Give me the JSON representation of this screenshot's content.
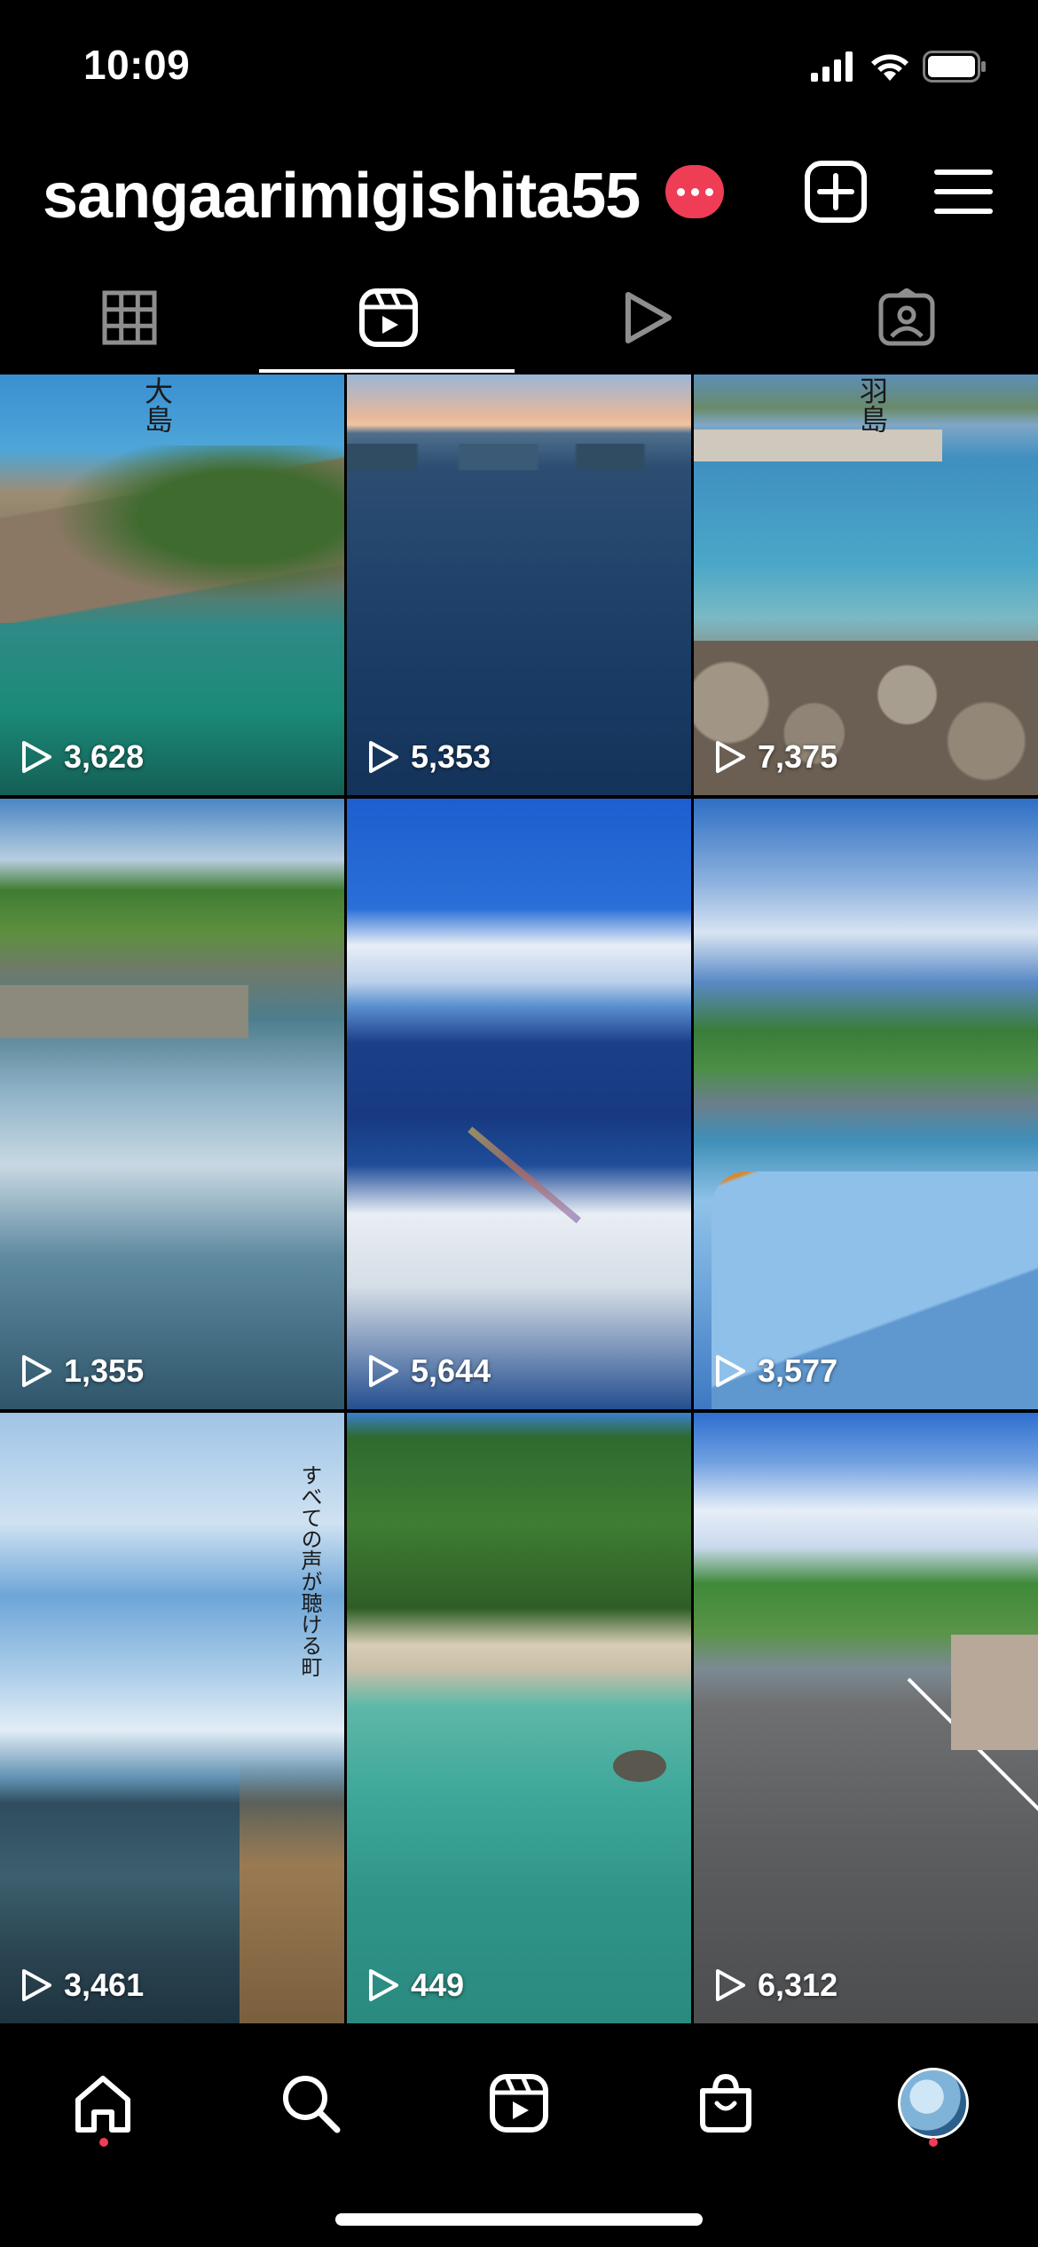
{
  "status_bar": {
    "time": "10:09"
  },
  "header": {
    "username": "sangaarimigishita55"
  },
  "tabs": [
    {
      "name": "grid",
      "icon": "grid-icon",
      "selected": false
    },
    {
      "name": "reels",
      "icon": "reels-icon",
      "selected": true
    },
    {
      "name": "videos",
      "icon": "play-icon",
      "selected": false
    },
    {
      "name": "tagged",
      "icon": "tagged-person-icon",
      "selected": false
    }
  ],
  "reels": [
    {
      "views": "3,628",
      "overlay_text": "大島"
    },
    {
      "views": "5,353"
    },
    {
      "views": "7,375",
      "overlay_text": "羽島"
    },
    {
      "views": "1,355"
    },
    {
      "views": "5,644"
    },
    {
      "views": "3,577"
    },
    {
      "views": "3,461",
      "overlay_text": "すべての声が聴ける町"
    },
    {
      "views": "449"
    },
    {
      "views": "6,312"
    }
  ],
  "bottom_nav": [
    {
      "name": "home",
      "icon": "home-icon",
      "notification_dot": true
    },
    {
      "name": "search",
      "icon": "search-icon",
      "notification_dot": false
    },
    {
      "name": "reels",
      "icon": "reels-icon",
      "notification_dot": false
    },
    {
      "name": "shop",
      "icon": "shop-bag-icon",
      "notification_dot": false
    },
    {
      "name": "profile",
      "icon": "avatar",
      "notification_dot": true
    }
  ],
  "colors": {
    "background": "#000000",
    "badge": "#ee3d55",
    "notification_dot": "#ee3d55"
  }
}
